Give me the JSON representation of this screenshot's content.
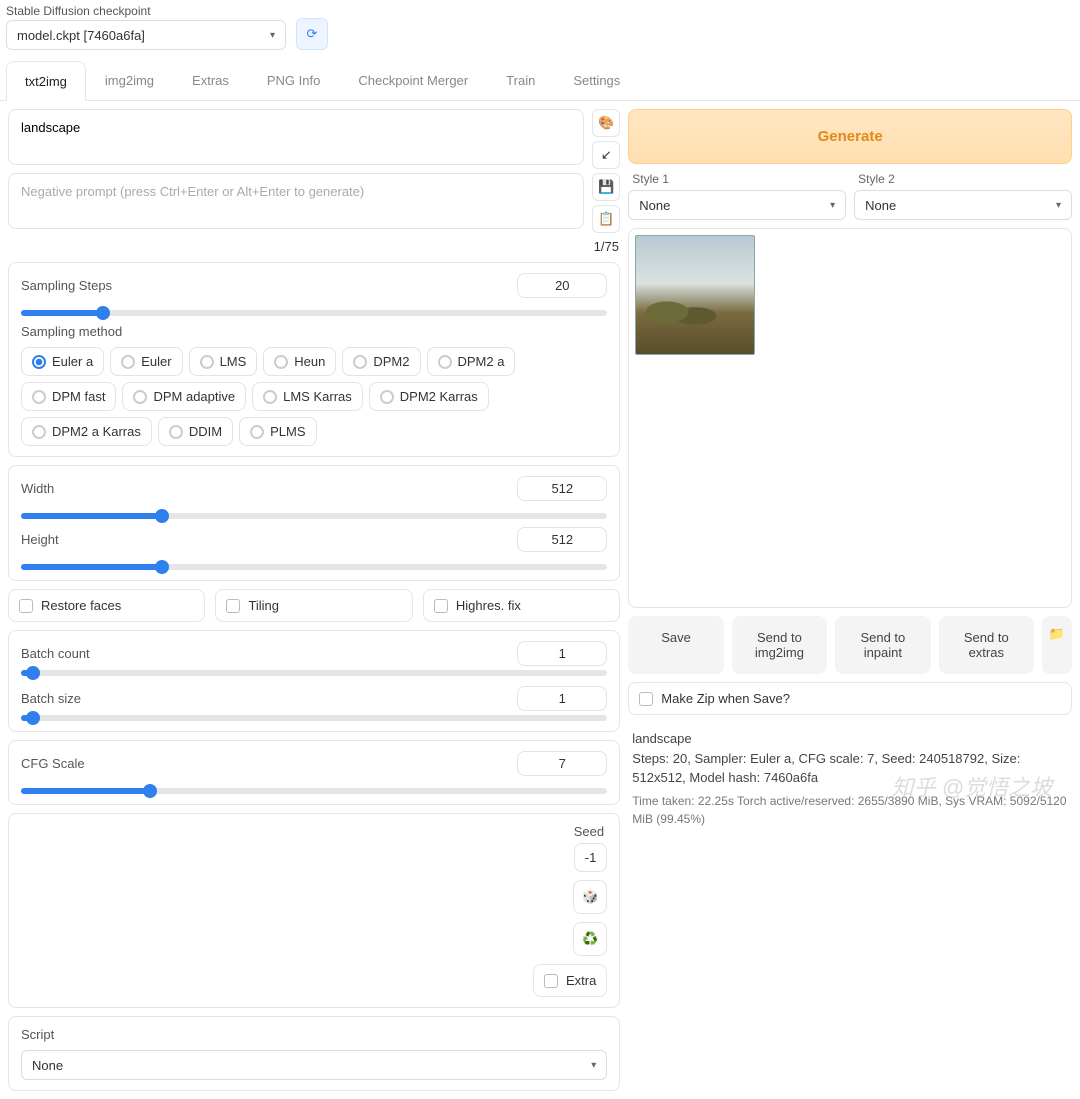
{
  "checkpoint": {
    "label": "Stable Diffusion checkpoint",
    "value": "model.ckpt [7460a6fa]"
  },
  "tabs": [
    "txt2img",
    "img2img",
    "Extras",
    "PNG Info",
    "Checkpoint Merger",
    "Train",
    "Settings"
  ],
  "activeTab": 0,
  "prompt": {
    "value": "landscape",
    "neg_placeholder": "Negative prompt (press Ctrl+Enter or Alt+Enter to generate)"
  },
  "tokencount": "1/75",
  "generate": "Generate",
  "styles": {
    "label1": "Style 1",
    "val1": "None",
    "label2": "Style 2",
    "val2": "None"
  },
  "sampling": {
    "steps_label": "Sampling Steps",
    "steps": "20",
    "method_label": "Sampling method",
    "methods": [
      "Euler a",
      "Euler",
      "LMS",
      "Heun",
      "DPM2",
      "DPM2 a",
      "DPM fast",
      "DPM adaptive",
      "LMS Karras",
      "DPM2 Karras",
      "DPM2 a Karras",
      "DDIM",
      "PLMS"
    ],
    "selected": "Euler a"
  },
  "dims": {
    "width_label": "Width",
    "width": "512",
    "height_label": "Height",
    "height": "512"
  },
  "checks": {
    "restore": "Restore faces",
    "tiling": "Tiling",
    "highres": "Highres. fix"
  },
  "batch": {
    "count_label": "Batch count",
    "count": "1",
    "size_label": "Batch size",
    "size": "1"
  },
  "cfg": {
    "label": "CFG Scale",
    "value": "7"
  },
  "seed": {
    "label": "Seed",
    "value": "-1",
    "extra": "Extra"
  },
  "script": {
    "label": "Script",
    "value": "None"
  },
  "actions": {
    "save": "Save",
    "img2img": "Send to img2img",
    "inpaint": "Send to inpaint",
    "extras": "Send to extras"
  },
  "zipcheck": "Make Zip when Save?",
  "info": {
    "prompt": "landscape",
    "params": "Steps: 20, Sampler: Euler a, CFG scale: 7, Seed: 240518792, Size: 512x512, Model hash: 7460a6fa",
    "time": "Time taken: 22.25s   Torch active/reserved: 2655/3890 MiB, Sys VRAM: 5092/5120 MiB (99.45%)"
  },
  "watermark": "知乎 @觉悟之坡"
}
